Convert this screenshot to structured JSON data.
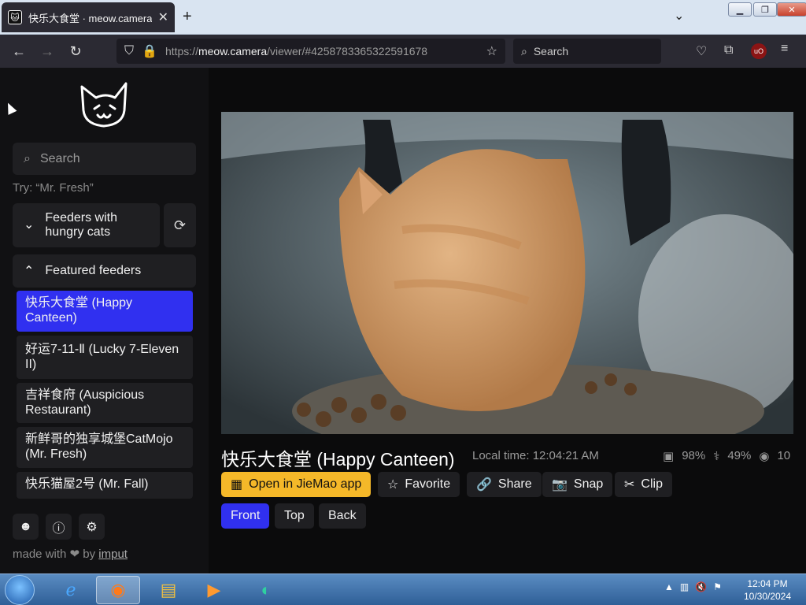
{
  "browser": {
    "tab_title": "快乐大食堂 · meow.camera",
    "tab_close": "✕",
    "new_tab": "+",
    "url_prefix": "https://",
    "url_host": "meow.camera",
    "url_rest": "/viewer/#4258783365322591678",
    "search_placeholder": "Search",
    "window_controls": [
      "minimize",
      "restore",
      "close"
    ]
  },
  "sidebar": {
    "search_placeholder": "Search",
    "hint": "Try: “Mr. Fresh”",
    "group_hungry": "Feeders with hungry cats",
    "group_featured": "Featured feeders",
    "feeders": [
      {
        "label": "快乐大食堂 (Happy Canteen)",
        "active": true
      },
      {
        "label": "好运7-11-Ⅱ (Lucky 7-Eleven II)",
        "active": false
      },
      {
        "label": "吉祥食府 (Auspicious Restaurant)",
        "active": false
      },
      {
        "label": "新鲜哥的独享城堡CatMojo (Mr. Fresh)",
        "active": false
      },
      {
        "label": "快乐猫屋2号 (Mr. Fall)",
        "active": false
      }
    ],
    "made_with": "made with ❤ by",
    "made_by": "imput"
  },
  "viewer": {
    "camera_name": "快乐大食堂 (Happy Canteen)",
    "local_time": "Local time: 12:04:21 AM",
    "stat_food": "98%",
    "stat_health": "49%",
    "stat_viewers": "10",
    "actions": {
      "open_app": "Open in JieMao app",
      "favorite": "Favorite",
      "share": "Share",
      "snap": "Snap",
      "clip": "Clip"
    },
    "views": {
      "front": "Front",
      "top": "Top",
      "back": "Back"
    }
  },
  "taskbar": {
    "time": "12:04 PM",
    "date": "10/30/2024"
  },
  "colors": {
    "accent_blue": "#3030f0",
    "accent_yellow": "#f5b829",
    "panel": "#1f1f22",
    "background": "#0b0b0c"
  }
}
